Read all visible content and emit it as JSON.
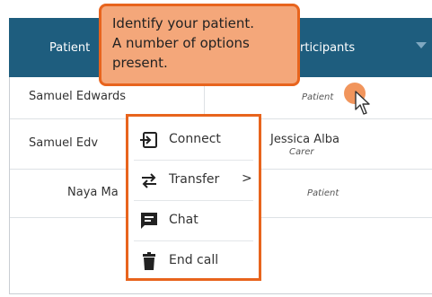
{
  "header": {
    "col1": "Patient",
    "col2": "rticipants"
  },
  "rows": [
    {
      "name": "Samuel Edwards",
      "participant": "Patient",
      "role": ""
    },
    {
      "name": "Samuel Edv",
      "participant": "Jessica Alba",
      "role": "Carer"
    },
    {
      "name": "Naya Ma",
      "participant": "Patient",
      "role": ""
    }
  ],
  "tooltip": {
    "lines": [
      "Identify your patient.",
      "A number of options",
      "present."
    ]
  },
  "menu": {
    "items": [
      {
        "label": "Connect",
        "icon": "connect-icon"
      },
      {
        "label": "Transfer",
        "icon": "transfer-icon",
        "has_submenu": true
      },
      {
        "label": "Chat",
        "icon": "chat-icon"
      },
      {
        "label": "End call",
        "icon": "trash-icon"
      }
    ],
    "submenu_indicator": ">"
  },
  "colors": {
    "header_bg": "#1e5d7e",
    "accent": "#e8641d",
    "tooltip_bg": "#f4a77a"
  }
}
